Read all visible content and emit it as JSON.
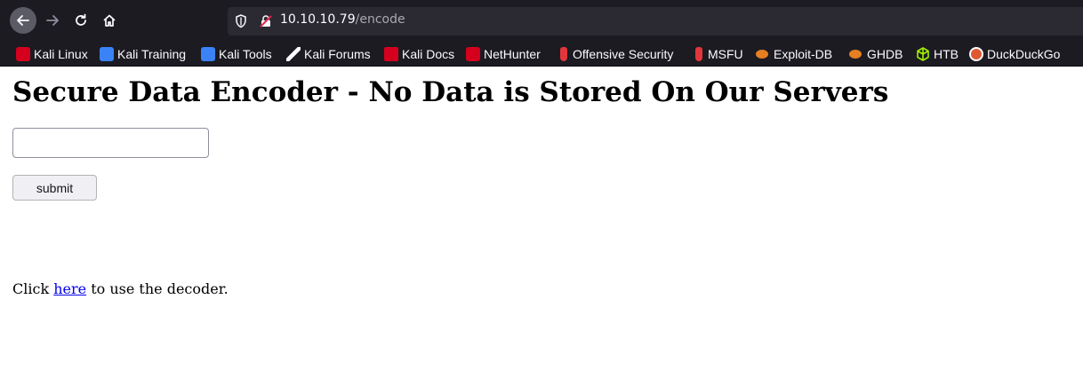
{
  "browser": {
    "url_host": "10.10.10.79",
    "url_path": "/encode",
    "bookmarks": [
      {
        "label": "Kali Linux",
        "icon": "kali-dragon-icon",
        "color": "#d4001d"
      },
      {
        "label": "Kali Training",
        "icon": "kali-training-icon",
        "color": "#3b82f6"
      },
      {
        "label": "Kali Tools",
        "icon": "kali-tools-icon",
        "color": "#3b82f6"
      },
      {
        "label": "Kali Forums",
        "icon": "kali-forums-icon",
        "color": "#ffffff"
      },
      {
        "label": "Kali Docs",
        "icon": "kali-docs-icon",
        "color": "#d4001d"
      },
      {
        "label": "NetHunter",
        "icon": "nethunter-icon",
        "color": "#d4001d"
      },
      {
        "label": "Offensive Security",
        "icon": "offsec-icon",
        "color": "#e2363b"
      },
      {
        "label": "MSFU",
        "icon": "msfu-icon",
        "color": "#e2363b"
      },
      {
        "label": "Exploit-DB",
        "icon": "exploit-db-icon",
        "color": "#e67e22"
      },
      {
        "label": "GHDB",
        "icon": "ghdb-icon",
        "color": "#e67e22"
      },
      {
        "label": "HTB",
        "icon": "htb-icon",
        "color": "#9fef00"
      },
      {
        "label": "DuckDuckGo",
        "icon": "duckduckgo-icon",
        "color": "#de5833"
      }
    ]
  },
  "page": {
    "title": "Secure Data Encoder - No Data is Stored On Our Servers",
    "input_value": "",
    "submit_label": "submit",
    "decoder_prefix": "Click ",
    "decoder_link": "here",
    "decoder_suffix": " to use the decoder."
  }
}
